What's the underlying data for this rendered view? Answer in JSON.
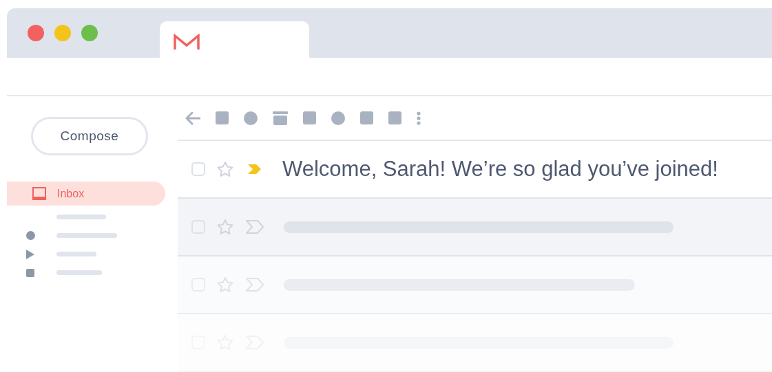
{
  "window": {
    "controls": [
      {
        "color": "#f26060"
      },
      {
        "color": "#f3c41c"
      },
      {
        "color": "#6dbf4b"
      }
    ]
  },
  "sidebar": {
    "compose": "Compose",
    "items": [
      {
        "label": "Inbox",
        "selected": true
      }
    ],
    "placeholders": [
      {
        "kind": "none"
      },
      {
        "kind": "dot"
      },
      {
        "kind": "play"
      },
      {
        "kind": "square"
      }
    ]
  },
  "toolbar": {
    "icons": [
      {
        "kind": "back"
      },
      {
        "kind": "square"
      },
      {
        "kind": "dot"
      },
      {
        "kind": "archive"
      },
      {
        "kind": "square"
      },
      {
        "kind": "dot"
      },
      {
        "kind": "square"
      },
      {
        "kind": "square"
      },
      {
        "kind": "more"
      }
    ]
  },
  "emails": [
    {
      "kind": "message",
      "subject": "Welcome, Sarah! We’re so glad you’ve joined!",
      "checked": false,
      "starred": false,
      "important": true
    },
    {
      "kind": "placeholder",
      "checked": false,
      "starred": false,
      "important": false
    },
    {
      "kind": "placeholder",
      "checked": false,
      "starred": false,
      "important": false
    },
    {
      "kind": "placeholder",
      "checked": false,
      "starred": false,
      "important": false
    }
  ]
}
